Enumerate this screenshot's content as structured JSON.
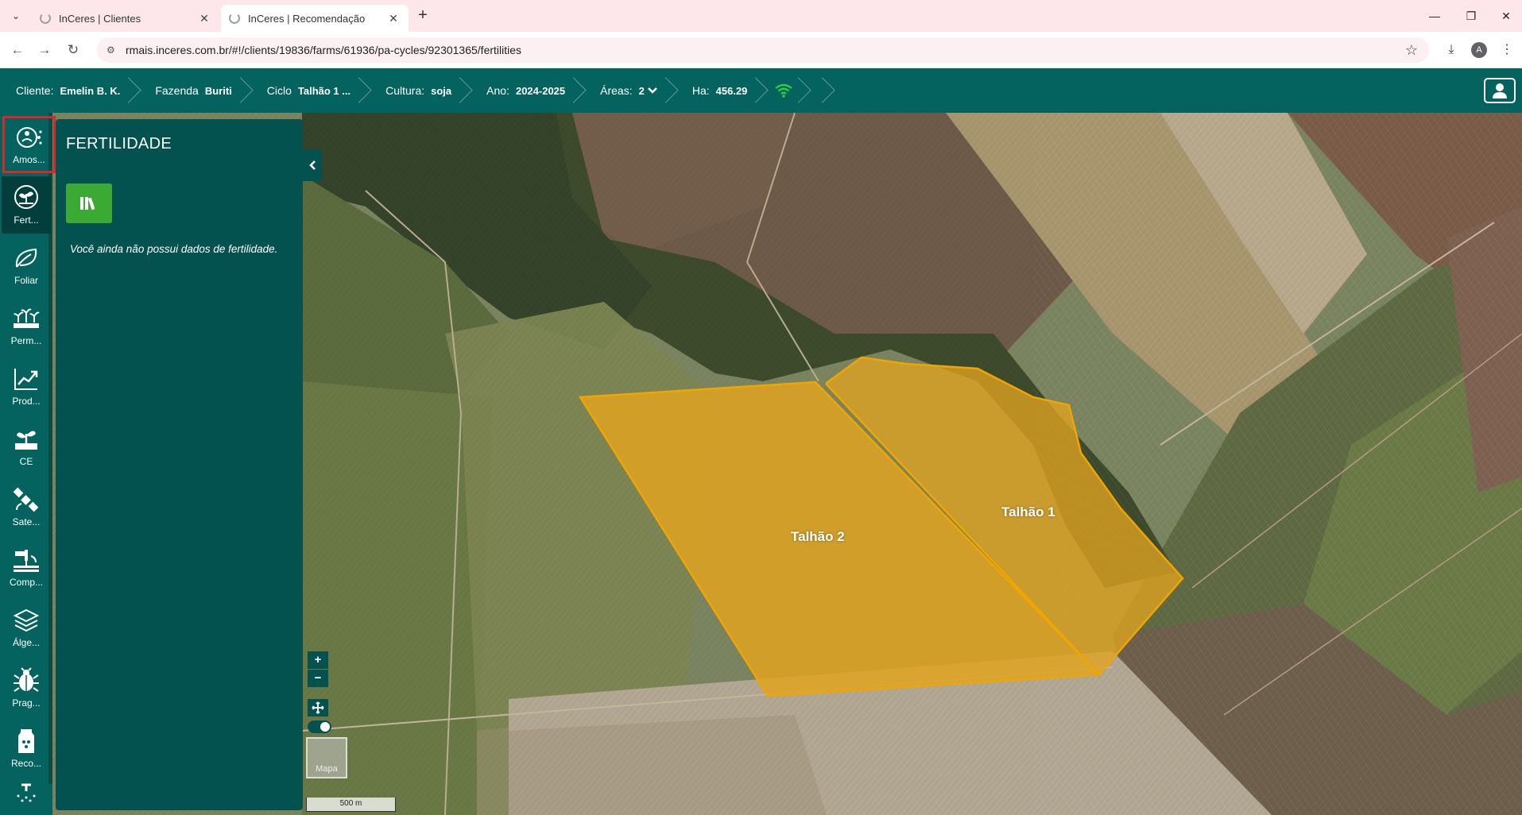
{
  "browser": {
    "tabs": [
      {
        "title": "InCeres | Clientes",
        "active": false
      },
      {
        "title": "InCeres | Recomendação",
        "active": true
      }
    ],
    "url": "rmais.inceres.com.br/#!/clients/19836/farms/61936/pa-cycles/92301365/fertilities",
    "profile_initial": "A"
  },
  "header": {
    "cliente_label": "Cliente:",
    "cliente_value": "Emelin B. K.",
    "fazenda_label": "Fazenda",
    "fazenda_value": "Buriti",
    "ciclo_label": "Ciclo",
    "ciclo_value": "Talhão 1 ...",
    "cultura_label": "Cultura:",
    "cultura_value": "soja",
    "ano_label": "Ano:",
    "ano_value": "2024-2025",
    "areas_label": "Áreas:",
    "areas_value": "2",
    "ha_label": "Ha:",
    "ha_value": "456.29",
    "wifi_color": "#2ecc40"
  },
  "sidebar": {
    "items": [
      {
        "label": "Amos...",
        "icon": "sampling-icon"
      },
      {
        "label": "Fert...",
        "icon": "fertility-icon"
      },
      {
        "label": "Foliar",
        "icon": "leaf-icon"
      },
      {
        "label": "Perm...",
        "icon": "plants-icon"
      },
      {
        "label": "Prod...",
        "icon": "chart-up-icon"
      },
      {
        "label": "CE",
        "icon": "seedling-icon"
      },
      {
        "label": "Sate...",
        "icon": "satellite-icon"
      },
      {
        "label": "Comp...",
        "icon": "compaction-icon"
      },
      {
        "label": "Álge...",
        "icon": "layers-icon"
      },
      {
        "label": "Prag...",
        "icon": "bug-icon"
      },
      {
        "label": "Reco...",
        "icon": "bag-icon"
      }
    ]
  },
  "panel": {
    "title": "FERTILIDADE",
    "empty_message": "Você ainda não possui dados de fertilidade."
  },
  "map": {
    "fields": [
      {
        "name": "Talhão 2"
      },
      {
        "name": "Talhão 1"
      }
    ],
    "field_color": "#e0a320",
    "basemap_label": "Mapa",
    "scale_label": "500 m",
    "zoom_in": "+",
    "zoom_out": "−"
  }
}
